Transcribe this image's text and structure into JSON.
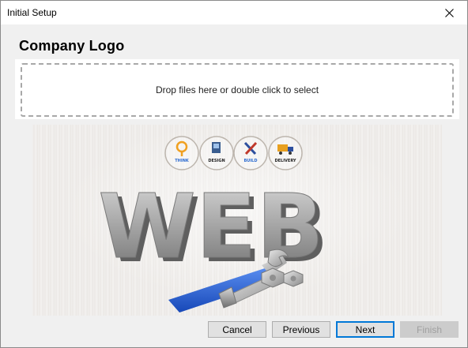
{
  "window": {
    "title": "Initial Setup",
    "close_icon": "close-icon"
  },
  "section": {
    "heading": "Company Logo"
  },
  "dropzone": {
    "text": "Drop files here or double click to select"
  },
  "preview": {
    "steps": [
      "THINK",
      "DESIGN",
      "BUILD",
      "DELIVERY"
    ],
    "big_text": "WEB"
  },
  "buttons": {
    "cancel": "Cancel",
    "previous": "Previous",
    "next": "Next",
    "finish": "Finish"
  },
  "colors": {
    "accent": "#0078d7",
    "wrench_blue": "#1f5fd8"
  }
}
